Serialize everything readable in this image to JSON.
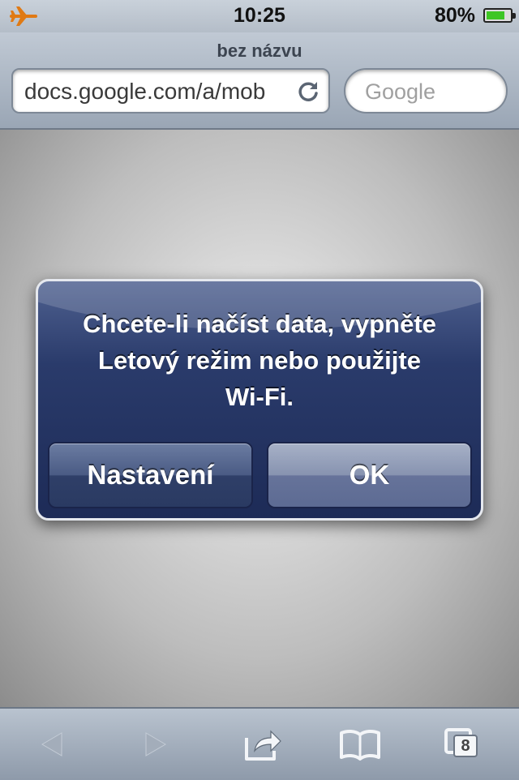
{
  "status_bar": {
    "time": "10:25",
    "battery_percent": "80%",
    "battery_level": 0.8,
    "icons": [
      "airplane-mode-icon",
      "battery-icon"
    ]
  },
  "browser": {
    "page_title": "bez názvu",
    "url": "docs.google.com/a/mob",
    "search_placeholder": "Google"
  },
  "alert": {
    "message_lines": [
      "Chcete-li načíst data, vypněte",
      "Letový režim nebo použijte",
      "Wi-Fi."
    ],
    "buttons": [
      "Nastavení",
      "OK"
    ]
  },
  "toolbar": {
    "tabs_count": "8",
    "icons": [
      "back-icon",
      "forward-icon",
      "share-icon",
      "bookmarks-icon",
      "tabs-icon"
    ]
  },
  "colors": {
    "alert_bg": "#1d2b57",
    "battery_green": "#3ec624",
    "airplane_orange": "#e07a14"
  }
}
